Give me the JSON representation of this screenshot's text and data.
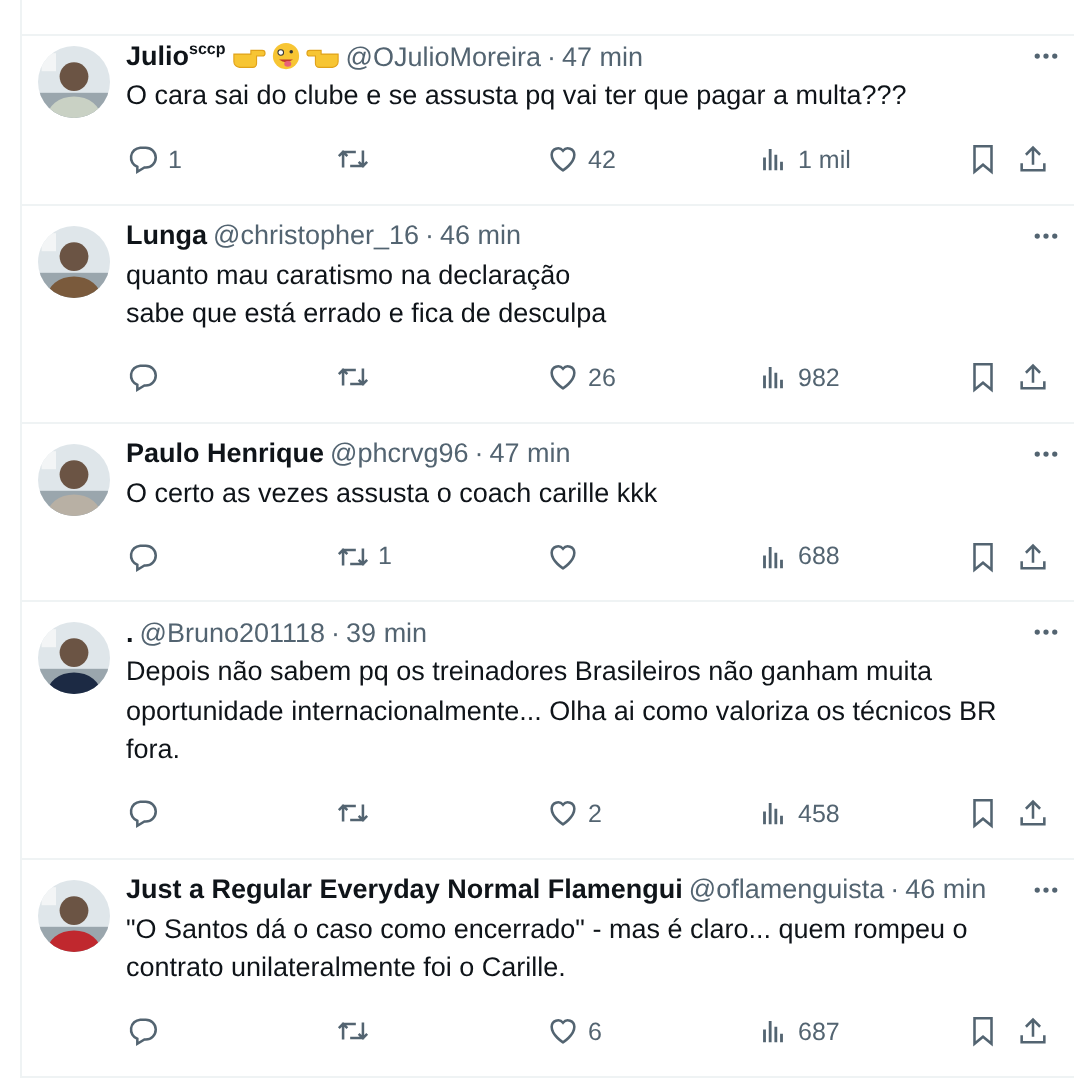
{
  "tweets": [
    {
      "name": "Julio$^{sccp}$",
      "emojis": [
        {
          "kind": "hand-right"
        },
        {
          "kind": "face"
        },
        {
          "kind": "hand-left"
        }
      ],
      "handle": "@OJulioMoreira",
      "separator": "·",
      "time": "47 min",
      "text": "O cara sai do clube e se assusta pq vai ter que pagar a multa???",
      "replies": "1",
      "likes": "42",
      "views": "1 mil"
    },
    {
      "name": "Lunga",
      "handle": "@christopher_16",
      "separator": "·",
      "time": "46 min",
      "text": "quanto mau caratismo na declaração\nsabe que está errado e fica de desculpa",
      "likes": "26",
      "views": "982"
    },
    {
      "name": "Paulo Henrique",
      "handle": "@phcrvg96",
      "separator": "·",
      "time": "47 min",
      "text": "O certo as vezes assusta o coach carille kkk",
      "retweets": "1",
      "views": "688"
    },
    {
      "name": ".",
      "handle": "@Bruno201118",
      "separator": "·",
      "time": "39 min",
      "text": "Depois não sabem pq os treinadores Brasileiros não ganham muita oportunidade internacionalmente... Olha ai como valoriza os técnicos BR fora.",
      "likes": "2",
      "views": "458"
    },
    {
      "name": "Just a Regular Everyday Normal Flamengui",
      "handle": "@oflamenguista",
      "separator": "·",
      "time": "46 min",
      "text": "\"O Santos dá o caso como encerrado\" - mas é claro... quem rompeu o contrato unilateralmente foi o Carille.",
      "likes": "6",
      "views": "687"
    }
  ]
}
